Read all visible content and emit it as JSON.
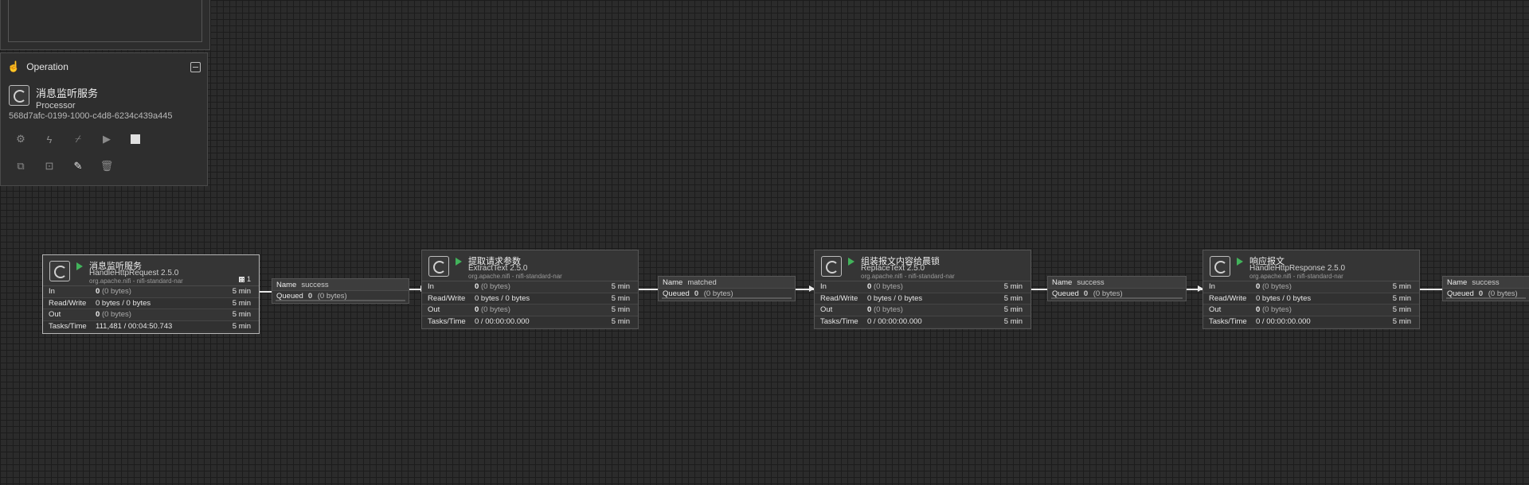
{
  "operation": {
    "title": "Operation",
    "component_name": "消息监听服务",
    "component_type": "Processor",
    "component_id": "568d7afc-0199-1000-c4d8-6234c439a445",
    "icons_row1": [
      "gear-icon",
      "lightning-icon",
      "disable-icon",
      "start-icon",
      "stop-icon"
    ],
    "icons_row2": [
      "copy-icon",
      "group-icon",
      "color-brush-icon",
      "delete-icon"
    ]
  },
  "processors": [
    {
      "name": "消息监听服务",
      "type": "HandleHttpRequest 2.5.0",
      "bundle": "org.apache.nifi - nifi-standard-nar",
      "threads": "1",
      "in": "0",
      "in_sub": "(0 bytes)",
      "in_time": "5 min",
      "rw": "0 bytes / 0 bytes",
      "rw_time": "5 min",
      "out": "0",
      "out_sub": "(0 bytes)",
      "out_time": "5 min",
      "tasks": "111,481 / 00:04:50.743",
      "tasks_time": "5 min"
    },
    {
      "name": "提取请求参数",
      "type": "ExtractText 2.5.0",
      "bundle": "org.apache.nifi - nifi-standard-nar",
      "in": "0",
      "in_sub": "(0 bytes)",
      "in_time": "5 min",
      "rw": "0 bytes / 0 bytes",
      "rw_time": "5 min",
      "out": "0",
      "out_sub": "(0 bytes)",
      "out_time": "5 min",
      "tasks": "0 / 00:00:00.000",
      "tasks_time": "5 min"
    },
    {
      "name": "组装报文内容给晨锁",
      "type": "ReplaceText 2.5.0",
      "bundle": "org.apache.nifi - nifi-standard-nar",
      "in": "0",
      "in_sub": "(0 bytes)",
      "in_time": "5 min",
      "rw": "0 bytes / 0 bytes",
      "rw_time": "5 min",
      "out": "0",
      "out_sub": "(0 bytes)",
      "out_time": "5 min",
      "tasks": "0 / 00:00:00.000",
      "tasks_time": "5 min"
    },
    {
      "name": "响应报文",
      "type": "HandleHttpResponse 2.5.0",
      "bundle": "org.apache.nifi - nifi-standard-nar",
      "in": "0",
      "in_sub": "(0 bytes)",
      "in_time": "5 min",
      "rw": "0 bytes / 0 bytes",
      "rw_time": "5 min",
      "out": "0",
      "out_sub": "(0 bytes)",
      "out_time": "5 min",
      "tasks": "0 / 00:00:00.000",
      "tasks_time": "5 min"
    }
  ],
  "stat_labels": {
    "in": "In",
    "rw": "Read/Write",
    "out": "Out",
    "tasks": "Tasks/Time"
  },
  "connections": [
    {
      "name_label": "Name",
      "name": "success",
      "queued_label": "Queued",
      "queued": "0",
      "queued_sub": "(0 bytes)"
    },
    {
      "name_label": "Name",
      "name": "matched",
      "queued_label": "Queued",
      "queued": "0",
      "queued_sub": "(0 bytes)"
    },
    {
      "name_label": "Name",
      "name": "success",
      "queued_label": "Queued",
      "queued": "0",
      "queued_sub": "(0 bytes)"
    },
    {
      "name_label": "Name",
      "name": "success",
      "queued_label": "Queued",
      "queued": "0",
      "queued_sub": "(0 bytes)"
    }
  ]
}
